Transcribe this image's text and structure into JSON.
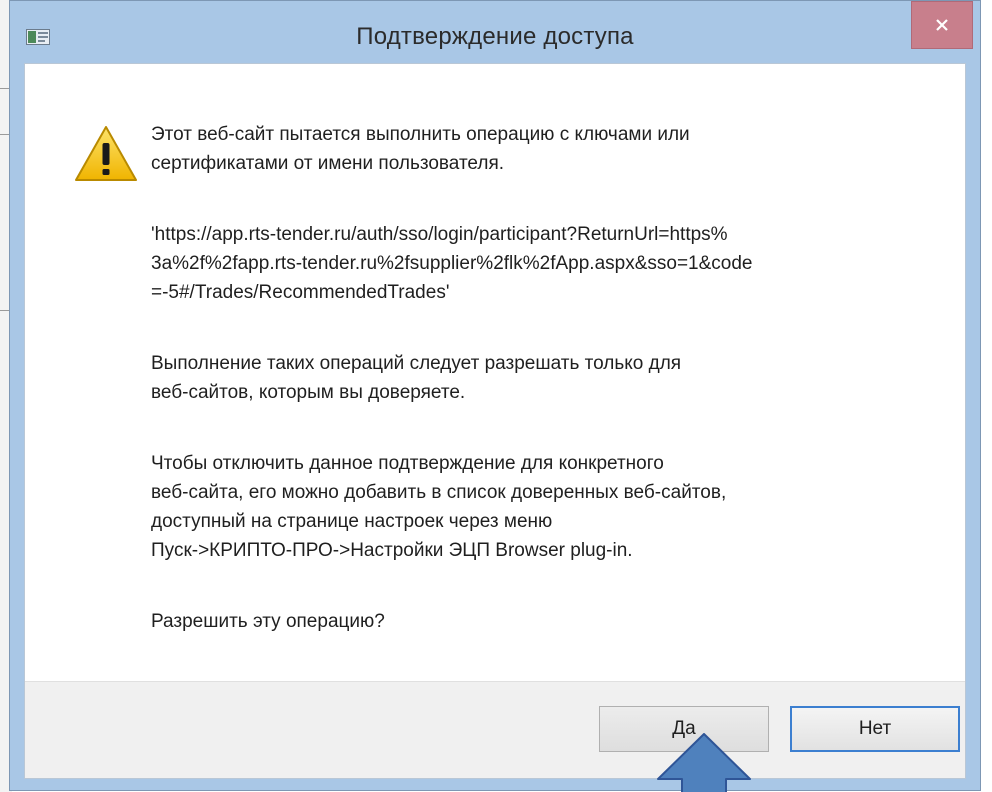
{
  "dialog": {
    "title": "Подтверждение доступа",
    "close_label": "×",
    "message": {
      "intro": "Этот веб-сайт пытается выполнить операцию с ключами или\nсертификатами от имени пользователя.",
      "url": "'https://app.rts-tender.ru/auth/sso/login/participant?ReturnUrl=https%\n3a%2f%2fapp.rts-tender.ru%2fsupplier%2flk%2fApp.aspx&sso=1&code\n=-5#/Trades/RecommendedTrades'",
      "warning": "Выполнение таких операций следует разрешать только для\nвеб-сайтов, которым вы доверяете.",
      "hint": "Чтобы отключить данное подтверждение для конкретного\nвеб-сайта, его можно добавить в список доверенных веб-сайтов,\nдоступный на странице настроек через меню\nПуск->КРИПТО-ПРО->Настройки ЭЦП Browser plug-in.",
      "question": "Разрешить эту операцию?"
    },
    "buttons": {
      "yes": "Да",
      "no": "Нет"
    }
  },
  "icons": {
    "window": "window-icon",
    "warning": "warning-icon",
    "close": "close-icon",
    "pointer": "arrow-up-icon"
  },
  "colors": {
    "frame": "#a9c7e6",
    "close_button": "#c87f8c",
    "button_bar": "#f0f0f0",
    "focused_border": "#3c7fd0",
    "warning_yellow": "#f5c517",
    "arrow_fill": "#4f81bd"
  }
}
